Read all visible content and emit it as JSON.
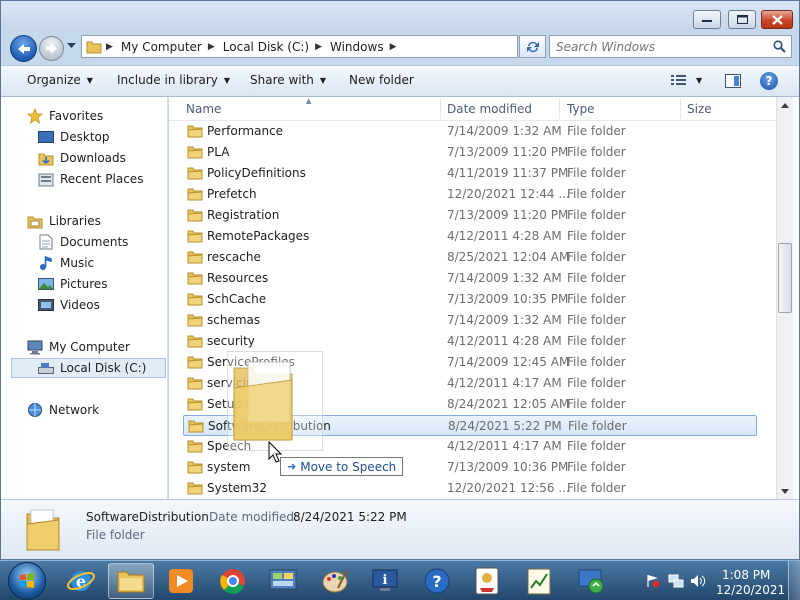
{
  "address": {
    "breadcrumbs": [
      "My Computer",
      "Local Disk (C:)",
      "Windows"
    ]
  },
  "search": {
    "placeholder": "Search Windows"
  },
  "toolbar": {
    "organize": "Organize",
    "include": "Include in library",
    "share": "Share with",
    "new_folder": "New folder"
  },
  "nav": {
    "favorites": "Favorites",
    "desktop": "Desktop",
    "downloads": "Downloads",
    "recent": "Recent Places",
    "libraries": "Libraries",
    "documents": "Documents",
    "music": "Music",
    "pictures": "Pictures",
    "videos": "Videos",
    "computer": "My Computer",
    "local_disk": "Local Disk (C:)",
    "network": "Network"
  },
  "columns": {
    "name": "Name",
    "date": "Date modified",
    "type": "Type",
    "size": "Size"
  },
  "rows": [
    {
      "name": "Performance",
      "date": "7/14/2009 1:32 AM",
      "type": "File folder"
    },
    {
      "name": "PLA",
      "date": "7/13/2009 11:20 PM",
      "type": "File folder"
    },
    {
      "name": "PolicyDefinitions",
      "date": "4/11/2019 11:37 PM",
      "type": "File folder"
    },
    {
      "name": "Prefetch",
      "date": "12/20/2021 12:44 ...",
      "type": "File folder"
    },
    {
      "name": "Registration",
      "date": "7/13/2009 11:20 PM",
      "type": "File folder"
    },
    {
      "name": "RemotePackages",
      "date": "4/12/2011 4:28 AM",
      "type": "File folder"
    },
    {
      "name": "rescache",
      "date": "8/25/2021 12:04 AM",
      "type": "File folder"
    },
    {
      "name": "Resources",
      "date": "7/14/2009 1:32 AM",
      "type": "File folder"
    },
    {
      "name": "SchCache",
      "date": "7/13/2009 10:35 PM",
      "type": "File folder"
    },
    {
      "name": "schemas",
      "date": "7/14/2009 1:32 AM",
      "type": "File folder"
    },
    {
      "name": "security",
      "date": "4/12/2011 4:28 AM",
      "type": "File folder"
    },
    {
      "name": "ServiceProfiles",
      "date": "7/14/2009 12:45 AM",
      "type": "File folder"
    },
    {
      "name": "servicing",
      "date": "4/12/2011 4:17 AM",
      "type": "File folder"
    },
    {
      "name": "Setup",
      "date": "8/24/2021 12:05 AM",
      "type": "File folder"
    },
    {
      "name": "SoftwareDistribution",
      "date": "8/24/2021 5:22 PM",
      "type": "File folder"
    },
    {
      "name": "Speech",
      "date": "4/12/2011 4:17 AM",
      "type": "File folder"
    },
    {
      "name": "system",
      "date": "7/13/2009 10:36 PM",
      "type": "File folder"
    },
    {
      "name": "System32",
      "date": "12/20/2021 12:56 ...",
      "type": "File folder"
    }
  ],
  "selected_row_index": 14,
  "details": {
    "name": "SoftwareDistribution",
    "modified_label": "Date modified:",
    "modified_value": "8/24/2021 5:22 PM",
    "type": "File folder"
  },
  "drag": {
    "tooltip": "Move to Speech"
  },
  "clock": {
    "time": "1:08 PM",
    "date": "12/20/2021"
  },
  "taskbar_icons": [
    "internet-explorer-icon",
    "file-explorer-icon",
    "media-player-icon",
    "chrome-icon",
    "control-panel-icon",
    "paint-icon",
    "system-info-icon",
    "help-icon",
    "solitaire-icon",
    "notepad-chart-icon",
    "windows-update-icon"
  ],
  "colors": {
    "folder": "#e8c25a",
    "selection": "#cfe3fa",
    "taskbar": "#2b5278"
  }
}
